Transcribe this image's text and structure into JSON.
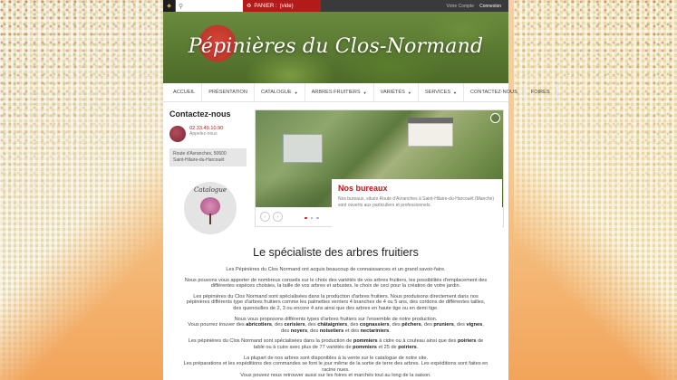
{
  "topbar": {
    "search_placeholder": "",
    "cart_label": "PANIER :",
    "cart_state": "(vide)",
    "account_link": "Votre Compte",
    "login_link": "Connexion"
  },
  "hero": {
    "title": "Pépinières du Clos-Normand"
  },
  "nav": {
    "items": [
      {
        "label": "ACCUEIL",
        "dropdown": false
      },
      {
        "label": "PRÉSENTATION",
        "dropdown": false
      },
      {
        "label": "CATALOGUE",
        "dropdown": true
      },
      {
        "label": "ARBRES FRUITIERS",
        "dropdown": true
      },
      {
        "label": "VARIÉTÉS",
        "dropdown": true
      },
      {
        "label": "SERVICES",
        "dropdown": true
      },
      {
        "label": "CONTACTEZ-NOUS",
        "dropdown": false
      },
      {
        "label": "FOIRES",
        "dropdown": false
      }
    ]
  },
  "sidebar": {
    "title": "Contactez-nous",
    "phone": "02.33.49.10.90",
    "phone_sub": "Appelez-nous",
    "address_line1": "Route d'Avranches, 50600",
    "address_line2": "Saint-Hilaire-du-Harcouët",
    "catalogue_label": "Catalogue"
  },
  "slider": {
    "caption_title": "Nos bureaux",
    "caption_text": "Nos bureaux, situés Route d'Avranches à Saint-Hilaire-du-Harcouët (Manche) sont ouverts aux particuliers et professionnels.",
    "prev_label": "‹",
    "next_label": "›"
  },
  "main": {
    "heading": "Le spécialiste des arbres fruitiers",
    "p1": "Les Pépinières du Clos Normand ont acquis beaucoup de connaissances et un grand savoir-faire.",
    "p2": "Nous pouvons vous apporter de nombreux conseils sur le choix des variétés de vos arbres fruitiers, les possibilités d'emplacement des différentes espèces choisies, la taille de vos arbres et arbustes, le choix de ceci pour la création de votre jardin.",
    "p3": "Les pépinières du Clos Normand sont spécialisées dans la production d'arbres fruitiers. Nous produisons directement dans nos pépinières différents type d'arbres fruitiers comme les palmettes verriers 4 branches de 4 ou 5 ans, des cordons de différentes tailles, des quenouilles de 2, 3 ou encore 4 ans ainsi que des arbres en haute tige ou en demi tige.",
    "p4_intro": "Nous vous proposons différents types d'arbres fruitiers sur l'ensemble de notre production.",
    "p4_a": "Vous pourrez trouver des ",
    "f1": "abricotiers",
    "s1": ", des ",
    "f2": "cerisiers",
    "s2": ", des ",
    "f3": "châtaigniers",
    "s3": ", des ",
    "f4": "cognassiers",
    "s4": ", des ",
    "f5": "pêchers",
    "s5": ", des ",
    "f6": "pruniers",
    "s6": ", des ",
    "f7": "vignes",
    "s7": ", des ",
    "f8": "noyers",
    "s8": ", des ",
    "f9": "noisetiers",
    "s9": " et des ",
    "f10": "nectariniers",
    "s10": ".",
    "p5_a": "Les pépinières du Clos Normand sont spécialisées dans la production de ",
    "p5_b": "pommiers",
    "p5_c": " à cidre ou à couteau ainsi que des ",
    "p5_d": "poiriers",
    "p5_e": " de table ou à cuire avec plus de 77 variétés de ",
    "p5_f": "pommiers",
    "p5_g": " et 25 de ",
    "p5_h": "poiriers",
    "p5_i": ".",
    "p6": "La plupart de nos arbres sont disponibles à la vente sur le catalogue de notre site.",
    "p7": "Les préparations et les expéditions des commandes se font le jour même de la sortie de terre des arbres. Les expéditions sont faites en racine nues.",
    "p8": "Vous pouvez nous retrouver aussi sur les foires et marchés tout au long de la saison."
  }
}
